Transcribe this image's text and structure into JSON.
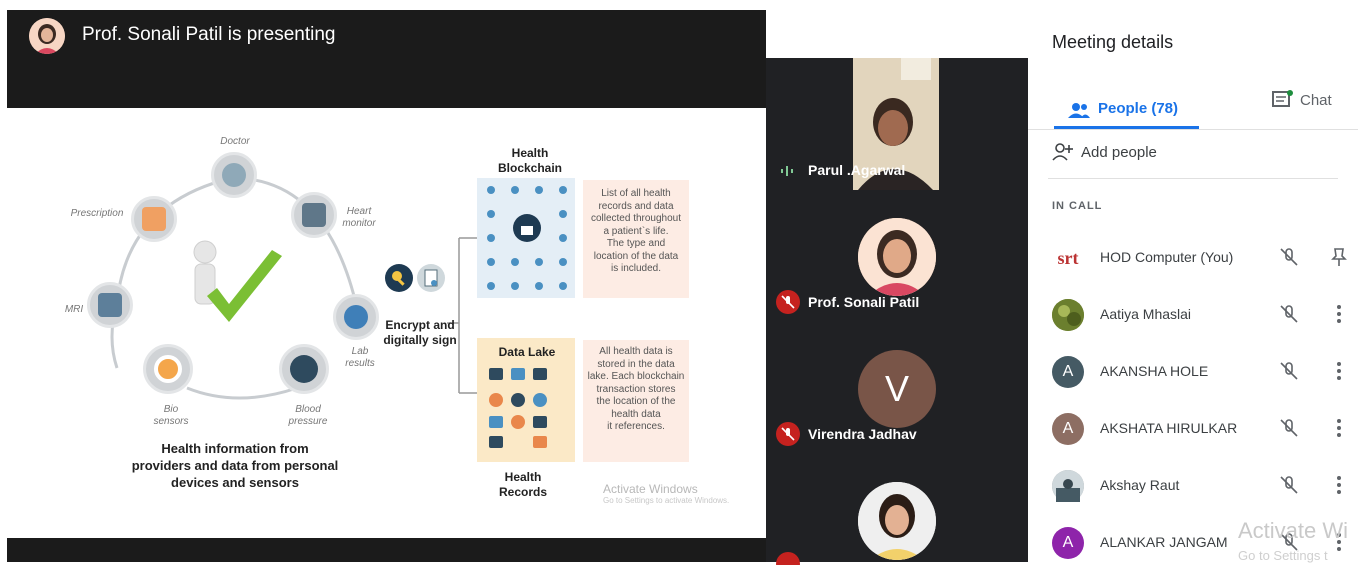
{
  "presenter": {
    "banner": "Prof. Sonali Patil is presenting"
  },
  "slide": {
    "labels": {
      "doctor": "Doctor",
      "prescription": "Prescription",
      "heart_monitor": "Heart\nmonitor",
      "mri": "MRI",
      "lab_results": "Lab\nresults",
      "bio_sensors": "Bio\nsensors",
      "blood_pressure": "Blood\npressure"
    },
    "health_info": "Health information from\nproviders and data from personal\ndevices and sensors",
    "encrypt": "Encrypt and\ndigitally sign",
    "health_blockchain": "Health\nBlockchain",
    "blockchain_desc": "List of all health\nrecords and data\ncollected throughout\na patient`s life.\nThe type and\nlocation of the data\nis included.",
    "data_lake": "Data Lake",
    "data_lake_desc": "All health data is\nstored in the data\nlake. Each blockchain\ntransaction stores\nthe location of the\nhealth data\nit references.",
    "health_records": "Health\nRecords",
    "activate": "Activate Windows",
    "activate_sub": "Go to Settings to activate Windows."
  },
  "tiles": [
    {
      "name": "Parul .Agarwal",
      "state": "speaking"
    },
    {
      "name": "Prof. Sonali Patil",
      "state": "muted"
    },
    {
      "name": "Virendra Jadhav",
      "state": "muted",
      "initial": "V"
    }
  ],
  "panel": {
    "title": "Meeting details",
    "people_tab": "People (78)",
    "chat_tab": "Chat",
    "add_people": "Add people",
    "in_call": "IN CALL"
  },
  "participants": [
    {
      "name": "HOD Computer (You)",
      "initial": "srt",
      "color": "#ffffff",
      "action": "pin"
    },
    {
      "name": "Aatiya Mhaslai",
      "initial": "",
      "color": "#7a8c3a",
      "action": "more"
    },
    {
      "name": "AKANSHA HOLE",
      "initial": "A",
      "color": "#455a64",
      "action": "more"
    },
    {
      "name": "AKSHATA HIRULKAR",
      "initial": "A",
      "color": "#8d6e63",
      "action": "more"
    },
    {
      "name": "Akshay Raut",
      "initial": "",
      "color": "#9e9e9e",
      "action": "more"
    },
    {
      "name": "ALANKAR JANGAM",
      "initial": "A",
      "color": "#8e24aa",
      "action": "more"
    }
  ],
  "windows_watermark": {
    "line1": "Activate Wi",
    "line2": "Go to Settings t"
  },
  "colors": {
    "accent": "#1a73e8",
    "muted_red": "#c5221f",
    "dark_bg": "#202124"
  }
}
